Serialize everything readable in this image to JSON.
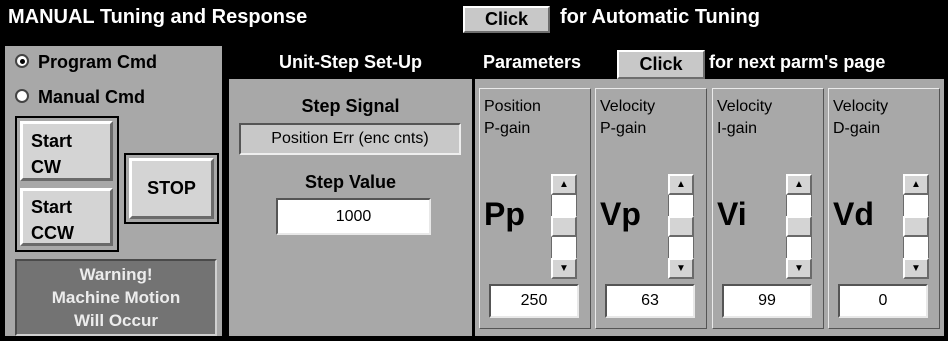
{
  "title_bar": {
    "title": "MANUAL Tuning and Response",
    "auto_button": "Click",
    "auto_text": "for Automatic Tuning"
  },
  "left_panel": {
    "radio_program": "Program Cmd",
    "radio_manual": "Manual Cmd",
    "selected": "Program Cmd",
    "start_cw_line1": "Start",
    "start_cw_line2": "CW",
    "start_ccw_line1": "Start",
    "start_ccw_line2": "CCW",
    "stop": "STOP",
    "warning_line1": "Warning!",
    "warning_line2": "Machine Motion",
    "warning_line3": "Will Occur"
  },
  "step_setup": {
    "header": "Unit-Step Set-Up",
    "signal_label": "Step Signal",
    "signal_value": "Position Err (enc cnts)",
    "value_label": "Step Value",
    "value": "1000"
  },
  "parameters": {
    "header": "Parameters",
    "click_button": "Click",
    "next_text": "for next parm's page",
    "cards": [
      {
        "name_line1": "Position",
        "name_line2": "P-gain",
        "symbol": "Pp",
        "value": "250"
      },
      {
        "name_line1": "Velocity",
        "name_line2": "P-gain",
        "symbol": "Vp",
        "value": "63"
      },
      {
        "name_line1": "Velocity",
        "name_line2": "I-gain",
        "symbol": "Vi",
        "value": "99"
      },
      {
        "name_line1": "Velocity",
        "name_line2": "D-gain",
        "symbol": "Vd",
        "value": "0"
      }
    ]
  },
  "icons": {
    "scroll_up": "▲",
    "scroll_down": "▼"
  }
}
